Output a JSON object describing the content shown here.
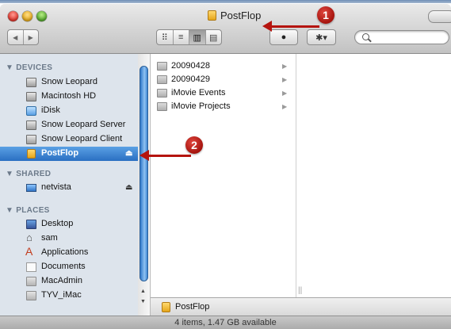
{
  "window": {
    "title": "PostFlop",
    "status": "4 items, 1.47 GB available"
  },
  "toolbar": {
    "back_glyph": "◀",
    "forward_glyph": "▶",
    "views": [
      {
        "name": "icon-view",
        "glyph": "⠿"
      },
      {
        "name": "list-view",
        "glyph": "≡"
      },
      {
        "name": "column-view",
        "glyph": "▥"
      },
      {
        "name": "coverflow-view",
        "glyph": "▤"
      }
    ],
    "quicklook_glyph": "●",
    "action_glyph": "✱▾",
    "search": {
      "value": "",
      "placeholder": ""
    }
  },
  "sidebar": {
    "devices_header": "▼ DEVICES",
    "devices": [
      {
        "label": "Snow Leopard",
        "icon": "disk"
      },
      {
        "label": "Macintosh HD",
        "icon": "disk"
      },
      {
        "label": "iDisk",
        "icon": "idisk"
      },
      {
        "label": "Snow Leopard Server",
        "icon": "disk"
      },
      {
        "label": "Snow Leopard Client",
        "icon": "disk"
      },
      {
        "label": "PostFlop",
        "icon": "vol",
        "selected": true,
        "eject": "⏏"
      }
    ],
    "shared_header": "▼ SHARED",
    "shared": [
      {
        "label": "netvista",
        "icon": "monitor",
        "eject": "⏏"
      }
    ],
    "places_header": "▼ PLACES",
    "places": [
      {
        "label": "Desktop",
        "icon": "desk"
      },
      {
        "label": "sam",
        "icon": "home"
      },
      {
        "label": "Applications",
        "icon": "apps"
      },
      {
        "label": "Documents",
        "icon": "doc"
      },
      {
        "label": "MacAdmin",
        "icon": "folder"
      },
      {
        "label": "TYV_iMac",
        "icon": "folder"
      }
    ]
  },
  "column1": {
    "items": [
      {
        "label": "20090428",
        "arrow": "▶"
      },
      {
        "label": "20090429",
        "arrow": "▶"
      },
      {
        "label": "iMovie Events",
        "arrow": "▶"
      },
      {
        "label": "iMovie Projects",
        "arrow": "▶"
      }
    ]
  },
  "pathbar": {
    "label": "PostFlop"
  },
  "callouts": [
    {
      "number": "1"
    },
    {
      "number": "2"
    }
  ],
  "colors": {
    "selection": "#2a6fc2",
    "callout_red": "#b5140e",
    "sidebar_bg": "#dde4ec"
  }
}
